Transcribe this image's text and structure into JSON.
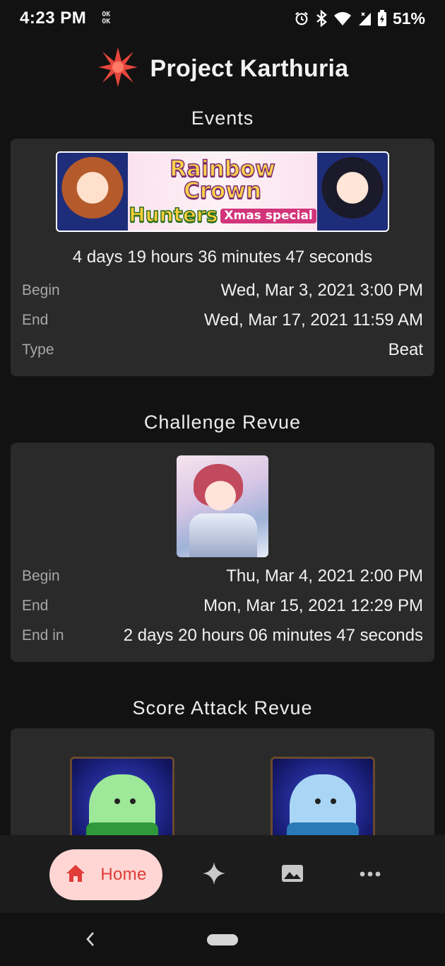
{
  "status_bar": {
    "time": "4:23 PM",
    "ok_top": "OK",
    "ok_bottom": "OK",
    "battery_percent": "51%"
  },
  "header": {
    "title": "Project Karthuria",
    "logo_icon": "starburst-logo-icon",
    "accent_color": "#e8463c"
  },
  "events": {
    "section_title": "Events",
    "banner": {
      "line1": "Rainbow Crown",
      "line2": "Hunters",
      "tag": "Xmas special"
    },
    "countdown": "4 days 19 hours 36 minutes 47 seconds",
    "rows": [
      {
        "label": "Begin",
        "value": "Wed, Mar 3, 2021 3:00 PM"
      },
      {
        "label": "End",
        "value": "Wed, Mar 17, 2021 11:59 AM"
      },
      {
        "label": "Type",
        "value": "Beat"
      }
    ]
  },
  "challenge": {
    "section_title": "Challenge Revue",
    "rows": [
      {
        "label": "Begin",
        "value": "Thu, Mar 4, 2021 2:00 PM"
      },
      {
        "label": "End",
        "value": "Mon, Mar 15, 2021 12:29 PM"
      },
      {
        "label": "End in",
        "value": "2 days 20 hours 06 minutes 47 seconds"
      }
    ]
  },
  "score_attack": {
    "section_title": "Score Attack Revue"
  },
  "bottom_nav": {
    "home_label": "Home",
    "active_bg": "#ffd6d3",
    "active_fg": "#e03c38",
    "items": [
      "home-icon",
      "sparkle-icon",
      "image-icon",
      "more-icon"
    ]
  }
}
